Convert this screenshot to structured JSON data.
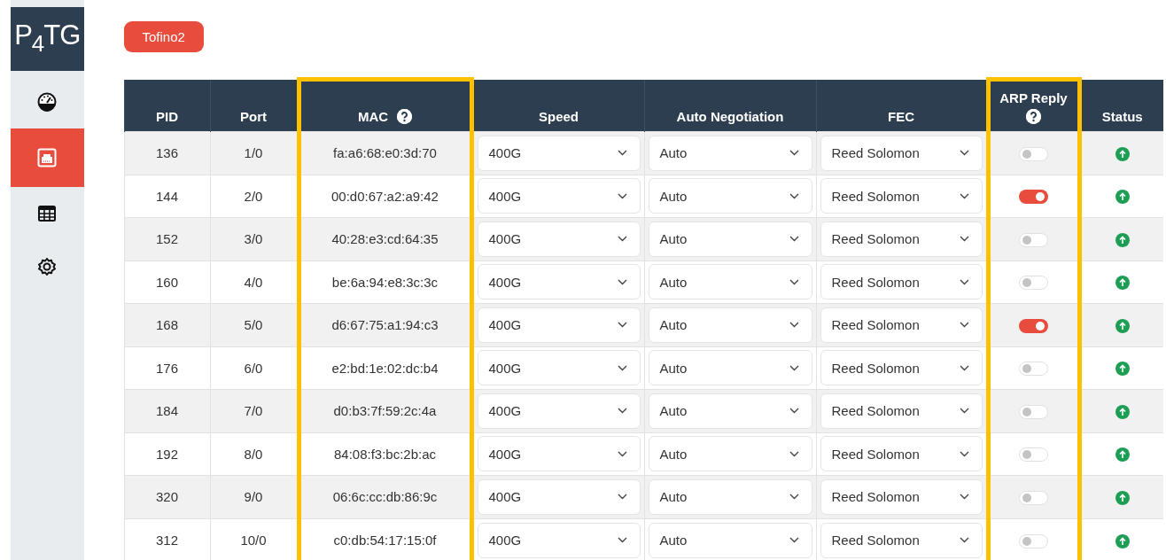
{
  "sidebar": {
    "logo": "P$_{4}$TG",
    "items": [
      {
        "kind": "gauge",
        "selected": false
      },
      {
        "kind": "ports",
        "selected": true
      },
      {
        "kind": "table",
        "selected": false
      },
      {
        "kind": "settings",
        "selected": false
      }
    ]
  },
  "device_button": "Tofino2",
  "table": {
    "columns": [
      {
        "label": "PID",
        "help": false,
        "highlighted": false
      },
      {
        "label": "Port",
        "help": false,
        "highlighted": false
      },
      {
        "label": "MAC",
        "help": true,
        "highlighted": true
      },
      {
        "label": "Speed",
        "help": false,
        "highlighted": false
      },
      {
        "label": "Auto Negotiation",
        "help": false,
        "highlighted": false
      },
      {
        "label": "FEC",
        "help": false,
        "highlighted": false
      },
      {
        "label": "ARP Reply",
        "help": true,
        "highlighted": true
      },
      {
        "label": "Status",
        "help": false,
        "highlighted": false
      }
    ],
    "rows": [
      {
        "pid": "136",
        "port": "1/0",
        "mac": "fa:a6:68:e0:3d:70",
        "speed": "400G",
        "auto_negotiation": "Auto",
        "fec": "Reed Solomon",
        "arp_reply": false,
        "link_up": true
      },
      {
        "pid": "144",
        "port": "2/0",
        "mac": "00:d0:67:a2:a9:42",
        "speed": "400G",
        "auto_negotiation": "Auto",
        "fec": "Reed Solomon",
        "arp_reply": true,
        "link_up": true
      },
      {
        "pid": "152",
        "port": "3/0",
        "mac": "40:28:e3:cd:64:35",
        "speed": "400G",
        "auto_negotiation": "Auto",
        "fec": "Reed Solomon",
        "arp_reply": false,
        "link_up": true
      },
      {
        "pid": "160",
        "port": "4/0",
        "mac": "be:6a:94:e8:3c:3c",
        "speed": "400G",
        "auto_negotiation": "Auto",
        "fec": "Reed Solomon",
        "arp_reply": false,
        "link_up": true
      },
      {
        "pid": "168",
        "port": "5/0",
        "mac": "d6:67:75:a1:94:c3",
        "speed": "400G",
        "auto_negotiation": "Auto",
        "fec": "Reed Solomon",
        "arp_reply": true,
        "link_up": true
      },
      {
        "pid": "176",
        "port": "6/0",
        "mac": "e2:bd:1e:02:dc:b4",
        "speed": "400G",
        "auto_negotiation": "Auto",
        "fec": "Reed Solomon",
        "arp_reply": false,
        "link_up": true
      },
      {
        "pid": "184",
        "port": "7/0",
        "mac": "d0:b3:7f:59:2c:4a",
        "speed": "400G",
        "auto_negotiation": "Auto",
        "fec": "Reed Solomon",
        "arp_reply": false,
        "link_up": true
      },
      {
        "pid": "192",
        "port": "8/0",
        "mac": "84:08:f3:bc:2b:ac",
        "speed": "400G",
        "auto_negotiation": "Auto",
        "fec": "Reed Solomon",
        "arp_reply": false,
        "link_up": true
      },
      {
        "pid": "320",
        "port": "9/0",
        "mac": "06:6c:cc:db:86:9c",
        "speed": "400G",
        "auto_negotiation": "Auto",
        "fec": "Reed Solomon",
        "arp_reply": false,
        "link_up": true
      },
      {
        "pid": "312",
        "port": "10/0",
        "mac": "c0:db:54:17:15:0f",
        "speed": "400G",
        "auto_negotiation": "Auto",
        "fec": "Reed Solomon",
        "arp_reply": false,
        "link_up": true
      }
    ]
  }
}
